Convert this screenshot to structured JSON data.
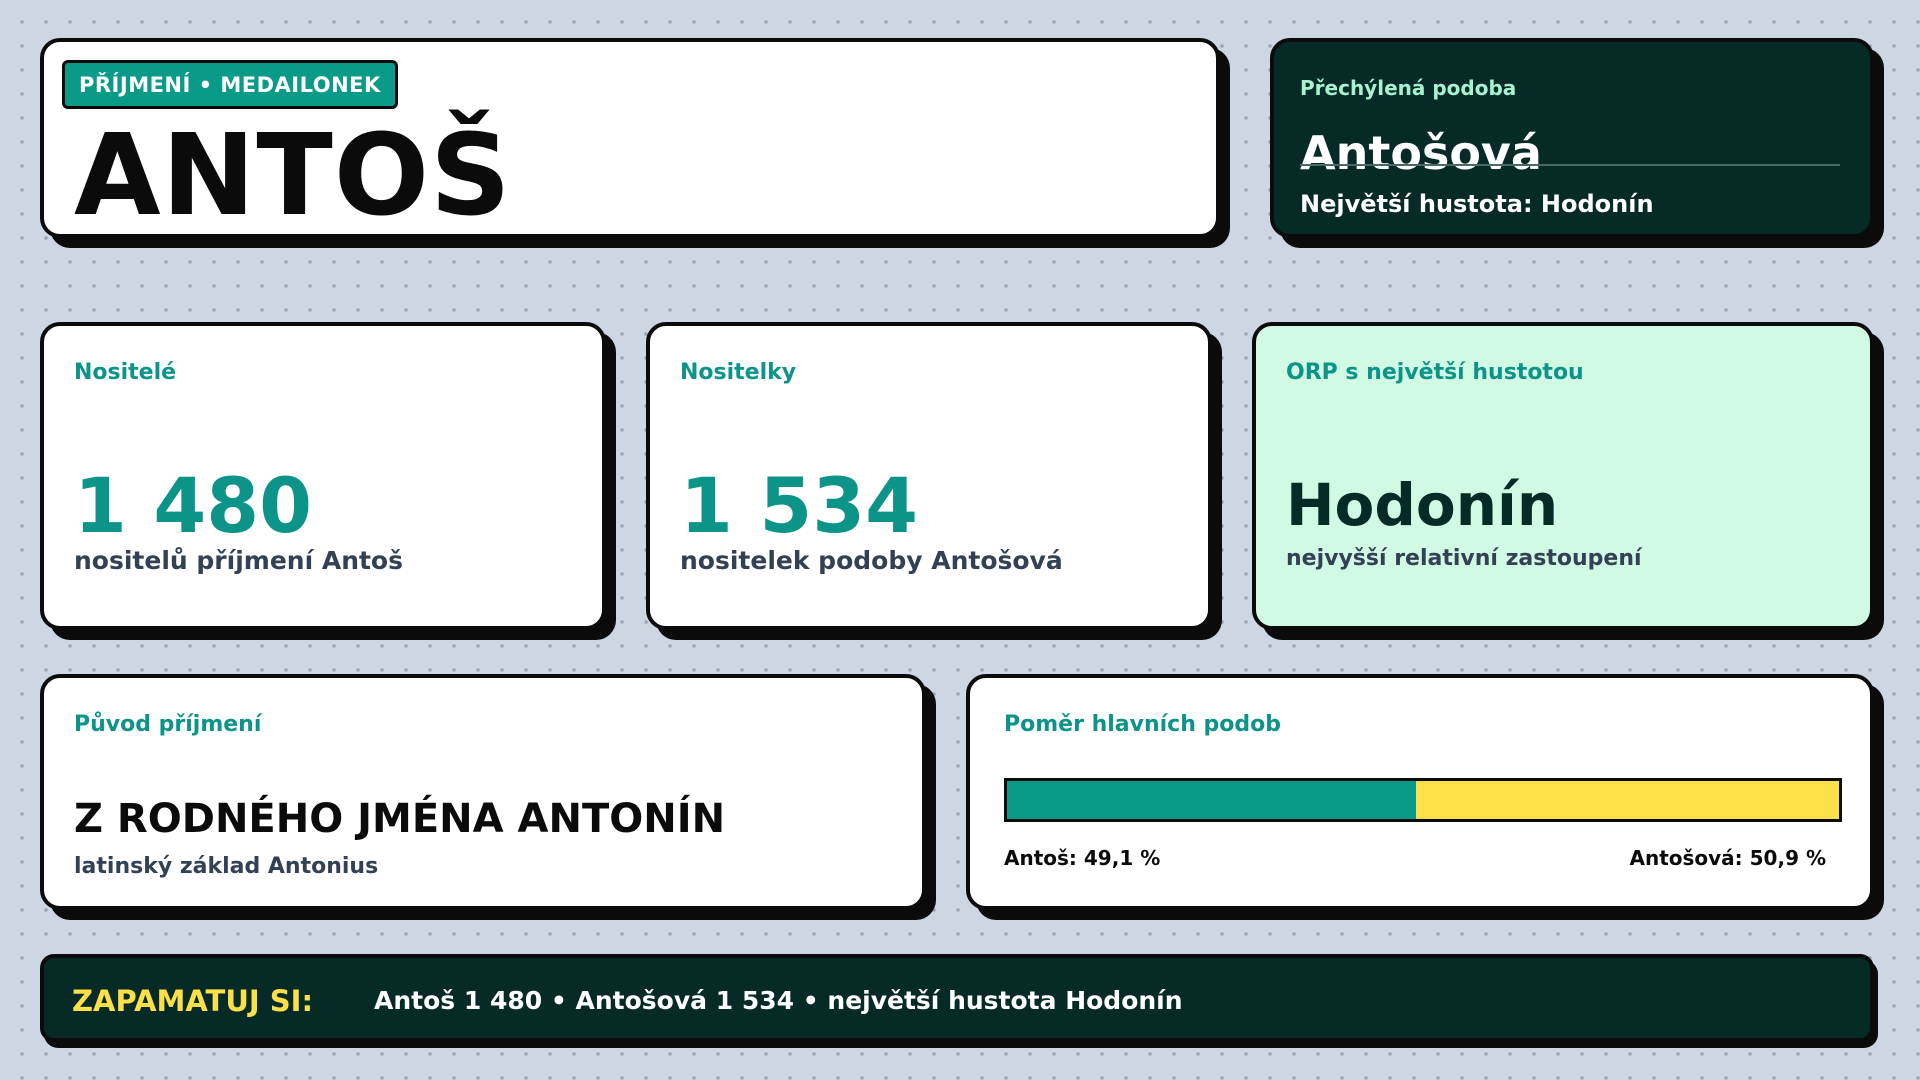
{
  "title": {
    "tag": "PŘÍJMENÍ • MEDAILONEK",
    "name": "ANTOŠ"
  },
  "variant": {
    "label": "Přechýlená podoba",
    "name": "Antošová",
    "density": "Největší hustota: Hodonín"
  },
  "stats": {
    "male": {
      "label": "Nositelé",
      "value": "1 480",
      "desc": "nositelů příjmení Antoš"
    },
    "female": {
      "label": "Nositelky",
      "value": "1 534",
      "desc": "nositelek podoby Antošová"
    },
    "orp": {
      "label": "ORP s největší hustotou",
      "value": "Hodonín",
      "desc": "nejvyšší relativní zastoupení"
    }
  },
  "origin": {
    "label": "Původ příjmení",
    "title": "Z RODNÉHO JMÉNA ANTONÍN",
    "sub": "latinský základ Antonius"
  },
  "ratio": {
    "label": "Poměr hlavních podob",
    "share_a": 49.1,
    "share_b": 50.9,
    "text_a": "Antoš: 49,1 %",
    "text_b": "Antošová: 50,9 %",
    "color_a": "#0a9a88",
    "color_b": "#fde047"
  },
  "footer": {
    "head": "ZAPAMATUJ SI:",
    "text": "Antoš 1 480 • Antošová 1 534 • největší hustota Hodonín"
  }
}
